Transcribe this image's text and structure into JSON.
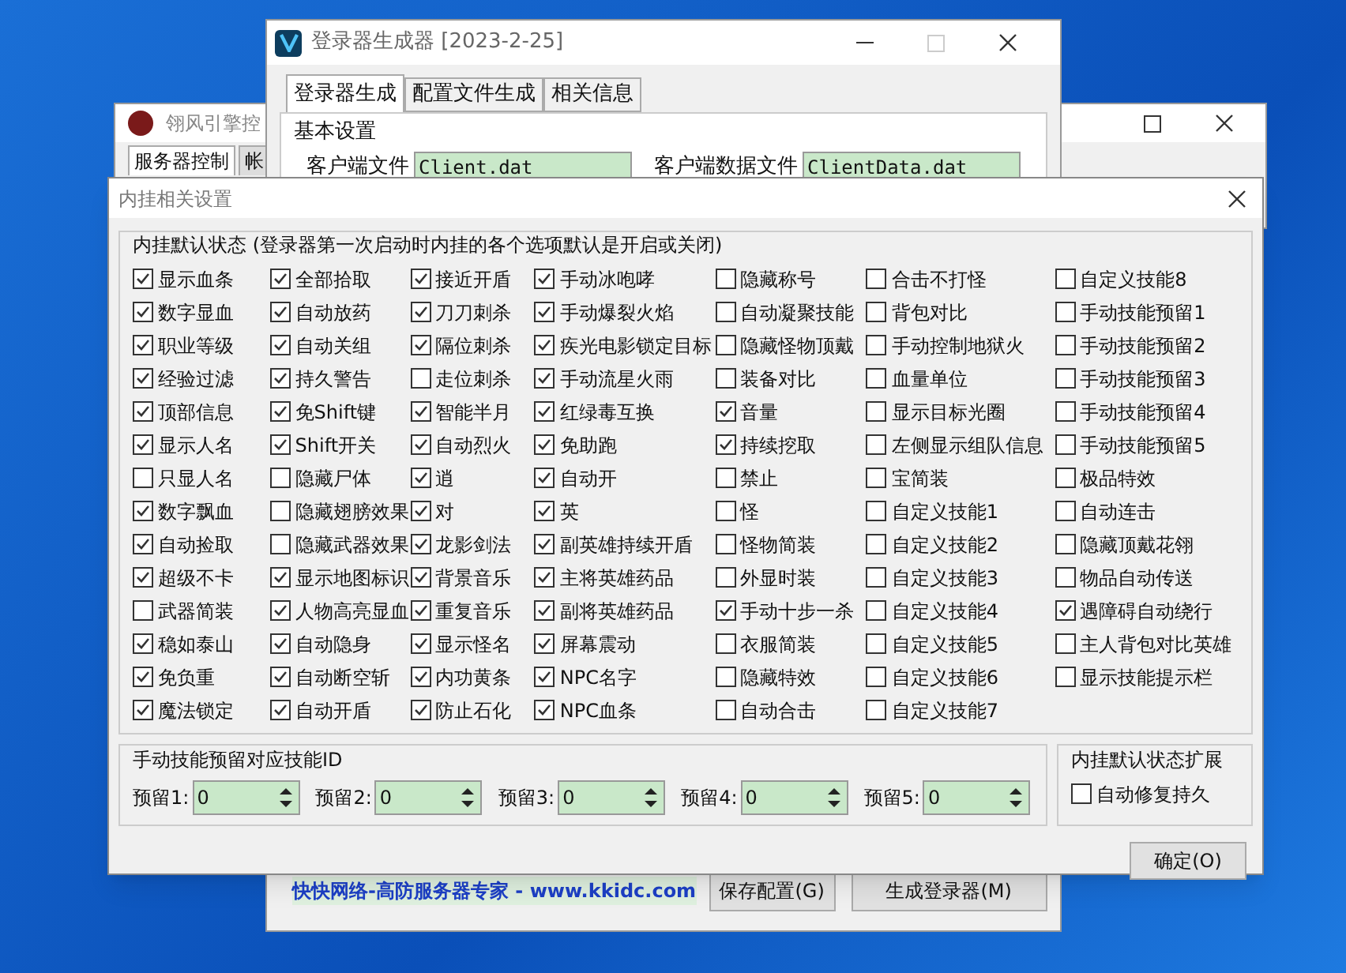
{
  "back_window": {
    "title": "翎风引擎控",
    "tabs": [
      {
        "label": "服务器控制",
        "selected": true
      },
      {
        "label": "帐",
        "selected": false
      }
    ]
  },
  "main_window": {
    "title": "登录器生成器 [2023-2-25]",
    "tabs": [
      {
        "label": "登录器生成",
        "selected": true
      },
      {
        "label": "配置文件生成",
        "selected": false
      },
      {
        "label": "相关信息",
        "selected": false
      }
    ],
    "group_title": "基本设置",
    "fields": [
      {
        "label": "客户端文件",
        "value": "Client.dat"
      },
      {
        "label": "客户端数据文件",
        "value": "ClientData.dat"
      }
    ],
    "link": "快快网络-高防服务器专家 - www.kkidc.com",
    "buttons": [
      "保存配置(G)",
      "生成登录器(M)"
    ]
  },
  "dialog": {
    "title": "内挂相关设置",
    "group_title": "内挂默认状态 (登录器第一次启动时内挂的各个选项默认是开启或关闭)",
    "columns": [
      [
        {
          "label": "显示血条",
          "checked": true
        },
        {
          "label": "数字显血",
          "checked": true
        },
        {
          "label": "职业等级",
          "checked": true
        },
        {
          "label": "经验过滤",
          "checked": true
        },
        {
          "label": "顶部信息",
          "checked": true
        },
        {
          "label": "显示人名",
          "checked": true
        },
        {
          "label": "只显人名",
          "checked": false
        },
        {
          "label": "数字飘血",
          "checked": true
        },
        {
          "label": "自动捡取",
          "checked": true
        },
        {
          "label": "超级不卡",
          "checked": true
        },
        {
          "label": "武器简装",
          "checked": false
        },
        {
          "label": "稳如泰山",
          "checked": true
        },
        {
          "label": "免负重",
          "checked": true
        },
        {
          "label": "魔法锁定",
          "checked": true
        }
      ],
      [
        {
          "label": "全部拾取",
          "checked": true
        },
        {
          "label": "自动放药",
          "checked": true
        },
        {
          "label": "自动关组",
          "checked": true
        },
        {
          "label": "持久警告",
          "checked": true
        },
        {
          "label": "免Shift键",
          "checked": true
        },
        {
          "label": "Shift开关",
          "checked": true
        },
        {
          "label": "隐藏尸体",
          "checked": false
        },
        {
          "label": "隐藏翅膀效果",
          "checked": false
        },
        {
          "label": "隐藏武器效果",
          "checked": false
        },
        {
          "label": "显示地图标识",
          "checked": true
        },
        {
          "label": "人物高亮显血",
          "checked": true
        },
        {
          "label": "自动隐身",
          "checked": true
        },
        {
          "label": "自动断空斩",
          "checked": true
        },
        {
          "label": "自动开盾",
          "checked": true
        }
      ],
      [
        {
          "label": "接近开盾",
          "checked": true
        },
        {
          "label": "刀刀刺杀",
          "checked": true
        },
        {
          "label": "隔位刺杀",
          "checked": true
        },
        {
          "label": "走位刺杀",
          "checked": false
        },
        {
          "label": "智能半月",
          "checked": true
        },
        {
          "label": "自动烈火",
          "checked": true
        },
        {
          "label": "逍",
          "checked": true
        },
        {
          "label": "对",
          "checked": true
        },
        {
          "label": "龙影剑法",
          "checked": true
        },
        {
          "label": "背景音乐",
          "checked": true
        },
        {
          "label": "重复音乐",
          "checked": true
        },
        {
          "label": "显示怪名",
          "checked": true
        },
        {
          "label": "内功黄条",
          "checked": true
        },
        {
          "label": "防止石化",
          "checked": true
        }
      ],
      [
        {
          "label": "手动冰咆哮",
          "checked": true
        },
        {
          "label": "手动爆裂火焰",
          "checked": true
        },
        {
          "label": "疾光电影锁定目标",
          "checked": true
        },
        {
          "label": "手动流星火雨",
          "checked": true
        },
        {
          "label": "红绿毒互换",
          "checked": true
        },
        {
          "label": "免助跑",
          "checked": true
        },
        {
          "label": "自动开",
          "checked": true
        },
        {
          "label": "英",
          "checked": true
        },
        {
          "label": "副英雄持续开盾",
          "checked": true
        },
        {
          "label": "主将英雄药品",
          "checked": true
        },
        {
          "label": "副将英雄药品",
          "checked": true
        },
        {
          "label": "屏幕震动",
          "checked": true
        },
        {
          "label": "NPC名字",
          "checked": true
        },
        {
          "label": "NPC血条",
          "checked": true
        }
      ],
      [
        {
          "label": "隐藏称号",
          "checked": false
        },
        {
          "label": "自动凝聚技能",
          "checked": false
        },
        {
          "label": "隐藏怪物顶戴",
          "checked": false
        },
        {
          "label": "装备对比",
          "checked": false
        },
        {
          "label": "音量",
          "checked": true
        },
        {
          "label": "持续挖取",
          "checked": true
        },
        {
          "label": "禁止",
          "checked": false
        },
        {
          "label": "怪",
          "checked": false
        },
        {
          "label": "怪物简装",
          "checked": false
        },
        {
          "label": "外显时装",
          "checked": false
        },
        {
          "label": "手动十步一杀",
          "checked": true
        },
        {
          "label": "衣服简装",
          "checked": false
        },
        {
          "label": "隐藏特效",
          "checked": false
        },
        {
          "label": "自动合击",
          "checked": false
        }
      ],
      [
        {
          "label": "合击不打怪",
          "checked": false
        },
        {
          "label": "背包对比",
          "checked": false
        },
        {
          "label": "手动控制地狱火",
          "checked": false
        },
        {
          "label": "血量单位",
          "checked": false
        },
        {
          "label": "显示目标光圈",
          "checked": false
        },
        {
          "label": "左侧显示组队信息",
          "checked": false
        },
        {
          "label": "宝简装",
          "checked": false
        },
        {
          "label": "自定义技能1",
          "checked": false
        },
        {
          "label": "自定义技能2",
          "checked": false
        },
        {
          "label": "自定义技能3",
          "checked": false
        },
        {
          "label": "自定义技能4",
          "checked": false
        },
        {
          "label": "自定义技能5",
          "checked": false
        },
        {
          "label": "自定义技能6",
          "checked": false
        },
        {
          "label": "自定义技能7",
          "checked": false
        }
      ],
      [
        {
          "label": "自定义技能8",
          "checked": false
        },
        {
          "label": "手动技能预留1",
          "checked": false
        },
        {
          "label": "手动技能预留2",
          "checked": false
        },
        {
          "label": "手动技能预留3",
          "checked": false
        },
        {
          "label": "手动技能预留4",
          "checked": false
        },
        {
          "label": "手动技能预留5",
          "checked": false
        },
        {
          "label": "极品特效",
          "checked": false
        },
        {
          "label": "自动连击",
          "checked": false
        },
        {
          "label": "隐藏顶戴花翎",
          "checked": false
        },
        {
          "label": "物品自动传送",
          "checked": false
        },
        {
          "label": "遇障碍自动绕行",
          "checked": true
        },
        {
          "label": "主人背包对比英雄",
          "checked": false
        },
        {
          "label": "显示技能提示栏",
          "checked": false
        }
      ]
    ],
    "reserve_group": {
      "title": "手动技能预留对应技能ID",
      "fields": [
        {
          "label": "预留1:",
          "value": "0"
        },
        {
          "label": "预留2:",
          "value": "0"
        },
        {
          "label": "预留3:",
          "value": "0"
        },
        {
          "label": "预留4:",
          "value": "0"
        },
        {
          "label": "预留5:",
          "value": "0"
        }
      ]
    },
    "extension_group": {
      "title": "内挂默认状态扩展",
      "option": {
        "label": "自动修复持久",
        "checked": false
      }
    },
    "ok_button": "确定(O)"
  }
}
